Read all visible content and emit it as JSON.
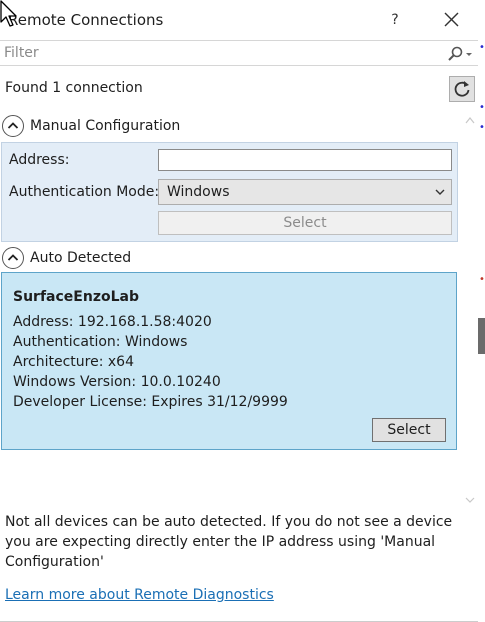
{
  "window": {
    "title": "Remote Connections",
    "help_label": "?"
  },
  "filter": {
    "placeholder": "Filter"
  },
  "status": {
    "found_text": "Found 1 connection"
  },
  "manual": {
    "header": "Manual Configuration",
    "address_label": "Address:",
    "address_value": "",
    "auth_label": "Authentication Mode:",
    "auth_value": "Windows",
    "select_label": "Select"
  },
  "auto": {
    "header": "Auto Detected",
    "device": {
      "name": "SurfaceEnzoLab",
      "address": "Address:  192.168.1.58:4020",
      "authentication": "Authentication:  Windows",
      "architecture": "Architecture:  x64",
      "windows_version": "Windows Version:  10.0.10240",
      "developer_license": "Developer License:  Expires 31/12/9999"
    },
    "select_label": "Select"
  },
  "footer": {
    "note": "Not all devices can be auto detected. If you do not see a device you are expecting directly enter the IP address using 'Manual Configuration'",
    "learn_more": "Learn more about Remote Diagnostics"
  },
  "colors": {
    "panel_blue": "#c9e7f5",
    "panel_border": "#5da4c9",
    "manual_bg": "#e3edf7",
    "link": "#1a6fb5"
  },
  "icons": [
    "close-icon",
    "search-icon",
    "dropdown-caret-icon",
    "refresh-icon",
    "collapse-chevron-icon",
    "scroll-up-icon",
    "scroll-down-icon",
    "mouse-cursor-icon"
  ]
}
